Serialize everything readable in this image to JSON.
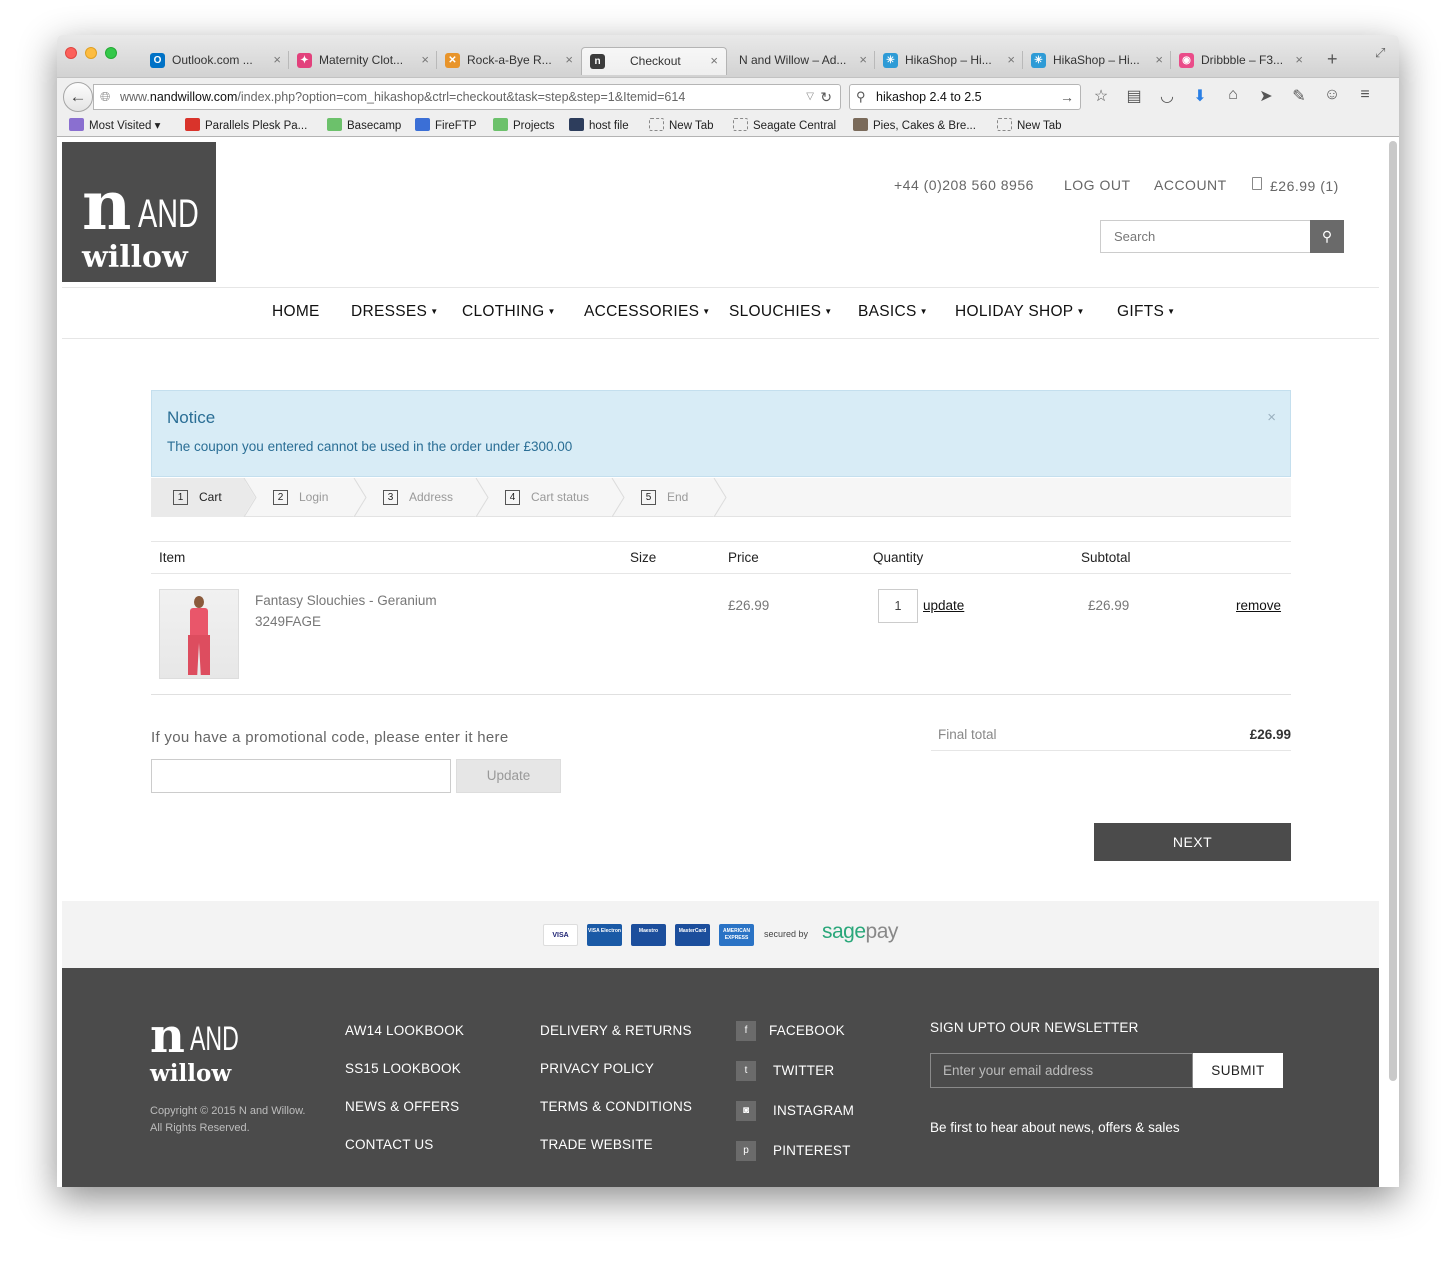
{
  "browser": {
    "tabs": [
      {
        "title": "Outlook.com ...",
        "icon_color": "#0072c6",
        "icon_text": "O"
      },
      {
        "title": "Maternity Clot...",
        "icon_color": "#e2417c",
        "icon_text": "✦"
      },
      {
        "title": "Rock-a-Bye R...",
        "icon_color": "#e8942a",
        "icon_text": "✕"
      },
      {
        "title": "Checkout",
        "icon_color": "#3c3c3c",
        "icon_text": "n"
      },
      {
        "title": "N and Willow – Ad...",
        "icon_color": "",
        "icon_text": ""
      },
      {
        "title": "HikaShop – Hi...",
        "icon_color": "#2e9bd6",
        "icon_text": "✳"
      },
      {
        "title": "HikaShop – Hi...",
        "icon_color": "#2e9bd6",
        "icon_text": "✳"
      },
      {
        "title": "Dribbble – F3...",
        "icon_color": "#ea4c89",
        "icon_text": "◉"
      }
    ],
    "url_prefix": "www.",
    "url_host": "nandwillow.com",
    "url_path": "/index.php?option=com_hikashop&ctrl=checkout&task=step&step=1&Itemid=614",
    "search_term": "hikashop 2.4 to 2.5",
    "bookmarks": [
      {
        "label": "Most Visited",
        "color": "#8a6fd0"
      },
      {
        "label": "Parallels Plesk Pa...",
        "color": "#d9332b"
      },
      {
        "label": "Basecamp",
        "color": "#6cc16b"
      },
      {
        "label": "FireFTP",
        "color": "#3b6fd6"
      },
      {
        "label": "Projects",
        "color": "#6cc16b"
      },
      {
        "label": "host file",
        "color": "#2d3d5c"
      },
      {
        "label": "New Tab",
        "color": ""
      },
      {
        "label": "Seagate Central",
        "color": ""
      },
      {
        "label": "Pies, Cakes & Bre...",
        "color": "#7a6a5a"
      },
      {
        "label": "New Tab",
        "color": ""
      }
    ]
  },
  "header": {
    "logo_n": "n",
    "logo_and": "AND",
    "logo_willow": "willow",
    "phone": "+44 (0)208 560 8956",
    "logout": "LOG OUT",
    "account": "ACCOUNT",
    "cart": "£26.99 (1)",
    "search_placeholder": "Search"
  },
  "nav": [
    {
      "label": "HOME",
      "caret": ""
    },
    {
      "label": "DRESSES",
      "caret": "▼"
    },
    {
      "label": "CLOTHING",
      "caret": "▼"
    },
    {
      "label": "ACCESSORIES",
      "caret": "▼"
    },
    {
      "label": "SLOUCHIES",
      "caret": "▼"
    },
    {
      "label": "BASICS",
      "caret": "▼"
    },
    {
      "label": "HOLIDAY SHOP",
      "caret": "▼"
    },
    {
      "label": "GIFTS",
      "caret": "▼"
    }
  ],
  "notice": {
    "title": "Notice",
    "message": "The coupon you entered cannot be used in the order under £300.00",
    "close": "×"
  },
  "steps": [
    {
      "num": "1",
      "label": "Cart"
    },
    {
      "num": "2",
      "label": "Login"
    },
    {
      "num": "3",
      "label": "Address"
    },
    {
      "num": "4",
      "label": "Cart status"
    },
    {
      "num": "5",
      "label": "End"
    }
  ],
  "cart": {
    "headers": {
      "item": "Item",
      "size": "Size",
      "price": "Price",
      "quantity": "Quantity",
      "subtotal": "Subtotal"
    },
    "rows": [
      {
        "name": "Fantasy Slouchies - Geranium",
        "sku": "3249FAGE",
        "size": "",
        "price": "£26.99",
        "quantity": "1",
        "update": "update",
        "subtotal": "£26.99",
        "remove": "remove"
      }
    ]
  },
  "promo": {
    "label": "If you have a promotional code, please enter it here",
    "value": "",
    "button": "Update"
  },
  "totals": {
    "label": "Final total",
    "value": "£26.99"
  },
  "next_button": "NEXT",
  "payment": {
    "cards": [
      {
        "label": "VISA",
        "bg": "#ffffff",
        "fg": "#1a1f71"
      },
      {
        "label": "VISA Electron",
        "bg": "#1a5aa6",
        "fg": "#ffffff"
      },
      {
        "label": "Maestro",
        "bg": "#1c4e9c",
        "fg": "#ffffff"
      },
      {
        "label": "MasterCard",
        "bg": "#1c4e9c",
        "fg": "#ffffff"
      },
      {
        "label": "AMERICAN EXPRESS",
        "bg": "#2a73c5",
        "fg": "#ffffff"
      }
    ],
    "secured_by": "secured by",
    "sage": "sage",
    "pay": "pay"
  },
  "footer": {
    "logo_n": "n",
    "logo_and": "AND",
    "logo_willow": "willow",
    "copyright": "Copyright © 2015 N and Willow. All Rights Reserved.",
    "col1": [
      "AW14 LOOKBOOK",
      "SS15 LOOKBOOK",
      "NEWS & OFFERS",
      "CONTACT US"
    ],
    "col2": [
      "DELIVERY & RETURNS",
      "PRIVACY POLICY",
      "TERMS & CONDITIONS",
      "TRADE WEBSITE"
    ],
    "social": [
      {
        "label": "FACEBOOK",
        "icon": "f"
      },
      {
        "label": "TWITTER",
        "icon": "t"
      },
      {
        "label": "INSTAGRAM",
        "icon": "◙"
      },
      {
        "label": "PINTEREST",
        "icon": "p"
      }
    ],
    "newsletter_title": "SIGN UPTO OUR NEWSLETTER",
    "newsletter_placeholder": "Enter your email address",
    "newsletter_button": "SUBMIT",
    "newsletter_sub": "Be first to hear about news, offers & sales"
  }
}
